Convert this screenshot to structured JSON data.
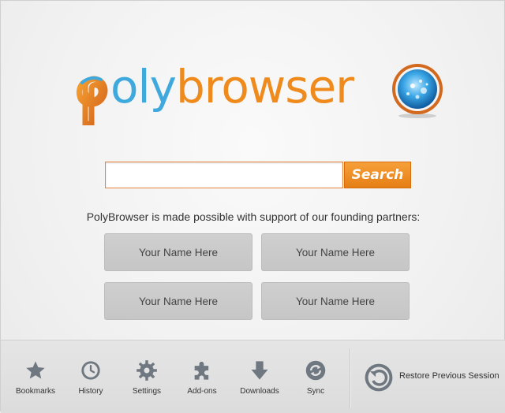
{
  "logo": {
    "text_p": "p",
    "text_oly": "oly",
    "text_browser": "browser",
    "alt": "polybrowser"
  },
  "search": {
    "value": "",
    "placeholder": "",
    "button_label": "Search"
  },
  "partners": {
    "intro": "PolyBrowser is made possible with support of our founding partners:",
    "tiles": [
      "Your Name Here",
      "Your Name Here",
      "Your Name Here",
      "Your Name Here"
    ]
  },
  "toolbar": {
    "items": [
      {
        "label": "Bookmarks",
        "icon": "star-icon"
      },
      {
        "label": "History",
        "icon": "clock-icon"
      },
      {
        "label": "Settings",
        "icon": "gear-icon"
      },
      {
        "label": "Add-ons",
        "icon": "puzzle-icon"
      },
      {
        "label": "Downloads",
        "icon": "download-arrow-icon"
      },
      {
        "label": "Sync",
        "icon": "sync-icon"
      }
    ],
    "restore_label": "Restore Previous Session"
  },
  "colors": {
    "orange": "#ef8b1d",
    "blue": "#3fa9de",
    "icon_gray": "#6f7880"
  }
}
